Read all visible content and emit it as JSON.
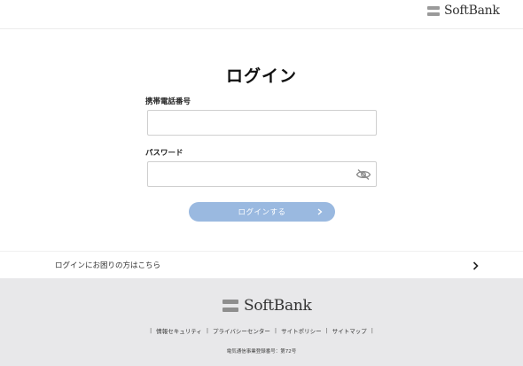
{
  "header": {
    "brand_name": "SoftBank"
  },
  "login": {
    "title": "ログイン",
    "phone_label": "携帯電話番号",
    "phone_value": "",
    "password_label": "パスワード",
    "password_value": "",
    "button_label": "ログインする",
    "button_color": "#9ab9e0",
    "eye_icon": "eye-off-icon"
  },
  "help": {
    "label": "ログインにお困りの方はこちら",
    "chevron_icon": "chevron-right-icon"
  },
  "footer": {
    "brand_name": "SoftBank",
    "links": [
      "情報セキュリティ",
      "プライバシーセンター",
      "サイトポリシー",
      "サイトマップ"
    ],
    "separator": "|",
    "license": "電気通信事業登録番号：第72号",
    "background": "#e8e8ea"
  }
}
